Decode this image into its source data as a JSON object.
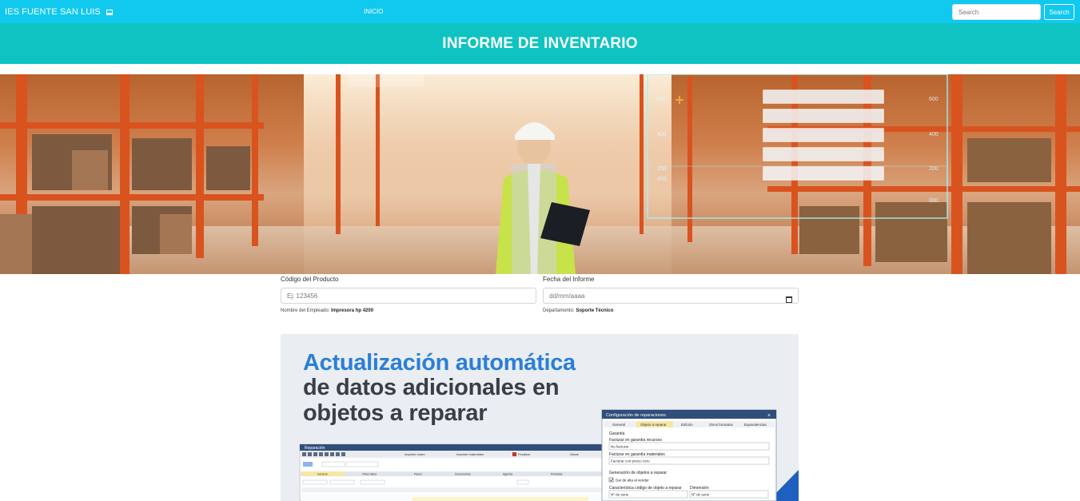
{
  "navbar": {
    "brand": "IES FUENTE SAN LUIS",
    "brand_icon": "monitor-icon",
    "nav_link": "INICIO",
    "search_placeholder": "Search",
    "search_button": "Search",
    "color": "#11c9ef"
  },
  "header": {
    "title": "INFORME DE INVENTARIO",
    "color": "#0fc3c3"
  },
  "hero": {
    "chart_ticks_left": [
      "600",
      "400",
      "200",
      "000"
    ],
    "chart_ticks_right": [
      "600",
      "400",
      "200",
      "000"
    ]
  },
  "form": {
    "product_code_label": "Código del Producto",
    "product_code_placeholder": "Ej: 123456",
    "employee_name_label": "Nombre del Empleado:",
    "employee_name_value": "Impresora hp 4200",
    "report_date_label": "Fecha del Informe",
    "report_date_placeholder": "dd/mm/aaaa",
    "department_label": "Departamento:",
    "department_value": "Soporte Técnico"
  },
  "promo": {
    "headline_line1": "Actualización automática",
    "headline_line2": "de datos adicionales en",
    "headline_line3": "objetos a reparar",
    "app_window_title": "Reparación",
    "dialog_title": "Configuración de reparaciones",
    "dialog_tabs": [
      "General",
      "Objeto a reparar",
      "Edición",
      "Otros formatos",
      "Equivalencias"
    ],
    "dialog_section1": "Garantía",
    "field1_label": "Facturar en garantía recursos",
    "field1_value": "No facturar",
    "field2_label": "Facturar en garantía materiales",
    "field2_value": "Facturar con precio cero",
    "dialog_section2": "Generación de objetos a reparar",
    "checkbox_label": "Dar de alta al vender",
    "field3_label": "Característica código de objeto a reparar",
    "field3_value": "Nº de serie",
    "field4_label": "Dimensión",
    "field4_value": "Nº de serie",
    "app_tabs": [
      "General",
      "Otros datos",
      "Pasos",
      "Documentos",
      "Agenda",
      "Previstos"
    ],
    "app_buttons": [
      "Imprimir orden",
      "Imprimir materiales",
      "Finalizar",
      "Aforar"
    ]
  }
}
